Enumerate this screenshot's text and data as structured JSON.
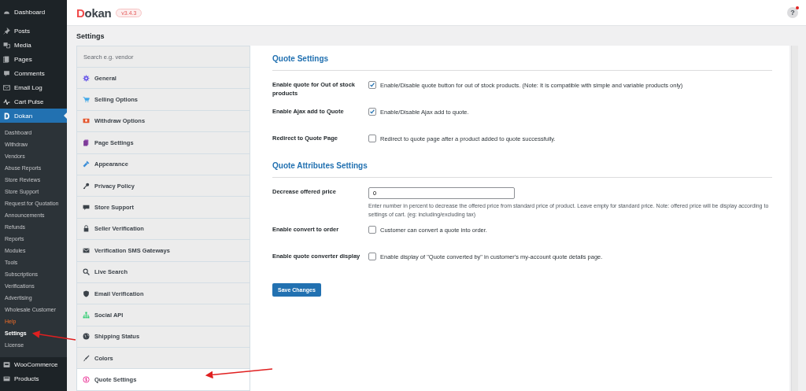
{
  "admin_menu": {
    "items": [
      {
        "label": "Dashboard",
        "selected": false
      },
      {
        "label": "Posts",
        "selected": false
      },
      {
        "label": "Media",
        "selected": false
      },
      {
        "label": "Pages",
        "selected": false
      },
      {
        "label": "Comments",
        "selected": false
      },
      {
        "label": "Email Log",
        "selected": false
      },
      {
        "label": "Cart Pulse",
        "selected": false
      },
      {
        "label": "Dokan",
        "selected": true,
        "children": [
          {
            "label": "Dashboard",
            "kind": "plain",
            "selected": false
          },
          {
            "label": "Withdraw",
            "kind": "plain",
            "selected": false
          },
          {
            "label": "Vendors",
            "kind": "plain",
            "selected": false
          },
          {
            "label": "Abuse Reports",
            "kind": "plain",
            "selected": false
          },
          {
            "label": "Store Reviews",
            "kind": "plain",
            "selected": false
          },
          {
            "label": "Store Support",
            "kind": "plain",
            "selected": false
          },
          {
            "label": "Request for Quotation",
            "kind": "plain",
            "selected": false
          },
          {
            "label": "Announcements",
            "kind": "plain",
            "selected": false
          },
          {
            "label": "Refunds",
            "kind": "plain",
            "selected": false
          },
          {
            "label": "Reports",
            "kind": "plain",
            "selected": false
          },
          {
            "label": "Modules",
            "kind": "plain",
            "selected": false
          },
          {
            "label": "Tools",
            "kind": "plain",
            "selected": false
          },
          {
            "label": "Subscriptions",
            "kind": "plain",
            "selected": false
          },
          {
            "label": "Verifications",
            "kind": "plain",
            "selected": false
          },
          {
            "label": "Advertising",
            "kind": "plain",
            "selected": false
          },
          {
            "label": "Wholesale Customer",
            "kind": "plain",
            "selected": false
          },
          {
            "label": "Help",
            "kind": "accent",
            "selected": false
          },
          {
            "label": "Settings",
            "kind": "plain",
            "selected": true
          },
          {
            "label": "License",
            "kind": "plain",
            "selected": false
          }
        ]
      },
      {
        "label": "WooCommerce",
        "selected": false
      },
      {
        "label": "Products",
        "selected": false
      }
    ]
  },
  "header": {
    "logo": "Dokan",
    "version": "v3.4.3",
    "help": "?"
  },
  "page_title": "Settings",
  "settings_menu": {
    "search": {
      "placeholder": "Search e.g. vendor"
    },
    "items": [
      {
        "label": "General",
        "selected": false
      },
      {
        "label": "Selling Options",
        "selected": false
      },
      {
        "label": "Withdraw Options",
        "selected": false
      },
      {
        "label": "Page Settings",
        "selected": false
      },
      {
        "label": "Appearance",
        "selected": false
      },
      {
        "label": "Privacy Policy",
        "selected": false
      },
      {
        "label": "Store Support",
        "selected": false
      },
      {
        "label": "Seller Verification",
        "selected": false
      },
      {
        "label": "Verification SMS Gateways",
        "selected": false
      },
      {
        "label": "Live Search",
        "selected": false
      },
      {
        "label": "Email Verification",
        "selected": false
      },
      {
        "label": "Social API",
        "selected": false
      },
      {
        "label": "Shipping Status",
        "selected": false
      },
      {
        "label": "Colors",
        "selected": false
      },
      {
        "label": "Quote Settings",
        "selected": true
      }
    ]
  },
  "sections": [
    {
      "title": "Quote Settings",
      "fields": [
        {
          "kind": "checkbox",
          "label": "Enable quote for Out of stock products",
          "checked": true,
          "description": "Enable/Disable quote button for out of stock products. (Note: It is compatible with simple and variable products only)"
        },
        {
          "kind": "checkbox",
          "label": "Enable Ajax add to Quote",
          "checked": true,
          "description": "Enable/Disable Ajax add to quote."
        },
        {
          "kind": "checkbox",
          "label": "Redirect to Quote Page",
          "checked": false,
          "description": "Redirect to quote page after a product added to quote successfully."
        }
      ]
    },
    {
      "title": "Quote Attributes Settings",
      "fields": [
        {
          "kind": "number",
          "label": "Decrease offered price",
          "value": "0",
          "help": "Enter number in percent to decrease the offered price from standard price of product. Leave empty for standard price. Note: offered price will be display according to settings of cart. (eg: including/excluding tax)"
        },
        {
          "kind": "checkbox",
          "label": "Enable convert to order",
          "checked": false,
          "description": "Customer can convert a quote into order."
        },
        {
          "kind": "checkbox",
          "label": "Enable quote converter display",
          "checked": false,
          "description": "Enable display of \"Quote converted by\" in customer's my-account quote details page."
        }
      ]
    }
  ],
  "save_button": "Save Changes"
}
